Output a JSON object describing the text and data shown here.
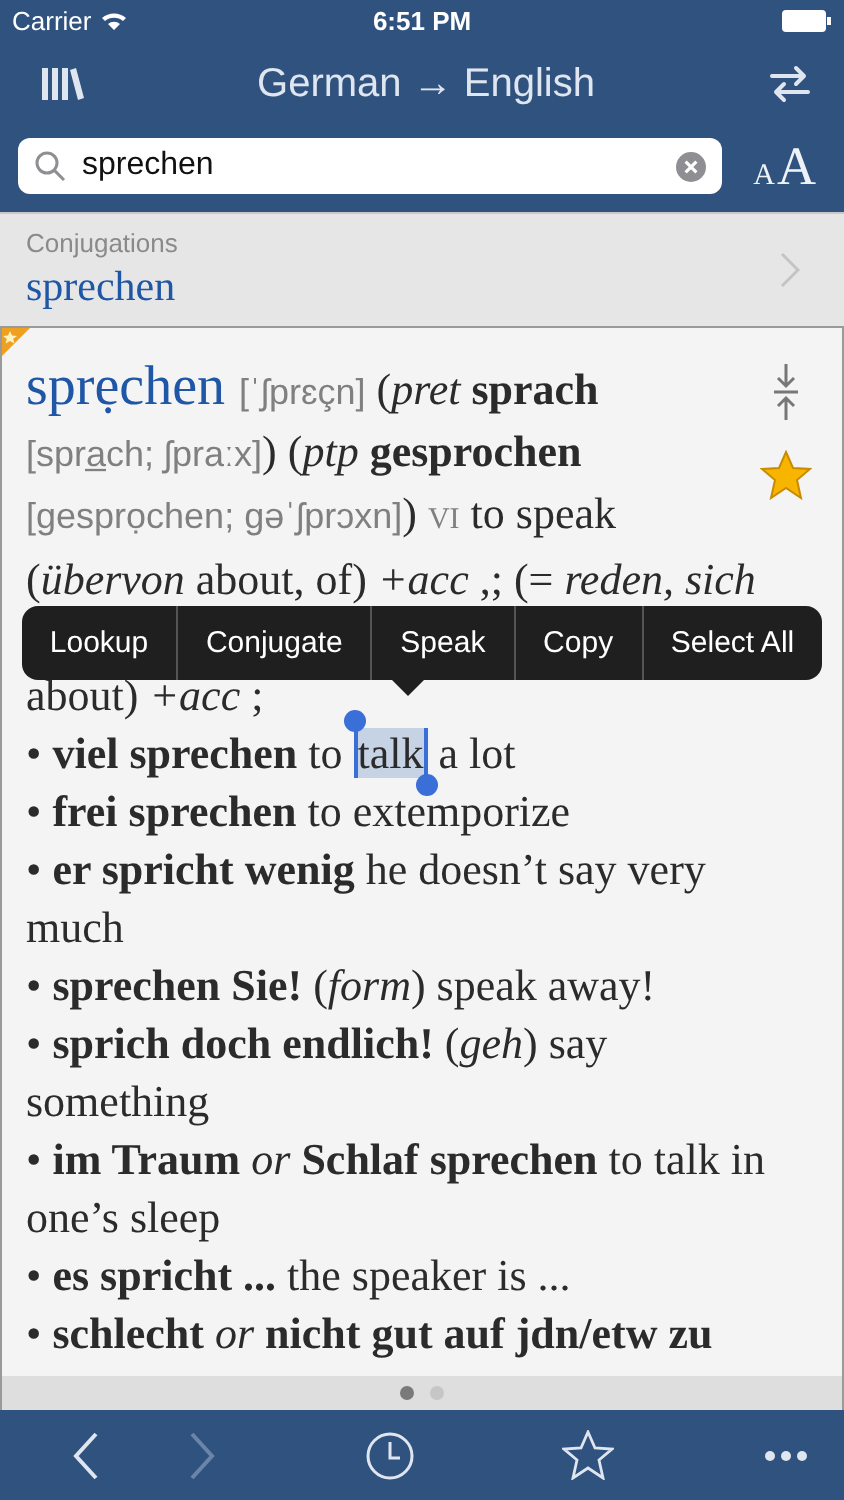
{
  "status_bar": {
    "carrier": "Carrier",
    "time": "6:51 PM"
  },
  "nav": {
    "title": "German → English"
  },
  "search": {
    "value": "sprechen",
    "font_button": {
      "small": "A",
      "large": "A"
    }
  },
  "conjugations": {
    "label": "Conjugations",
    "word": "sprechen"
  },
  "entry": {
    "bookmarked": true,
    "favorite": true,
    "head_lines": [
      [
        {
          "kind": "headword",
          "text": "sprẹchen "
        },
        {
          "kind": "phonetic",
          "text": "[ˈʃprɛçn]"
        },
        {
          "kind": "text",
          "text": " ("
        },
        {
          "kind": "italic",
          "text": "pret"
        },
        {
          "kind": "bold",
          "text": " sprach"
        }
      ],
      [
        {
          "kind": "phonetic",
          "text": "[spra̲ch; ʃpraːx]"
        },
        {
          "kind": "text",
          "text": ") ("
        },
        {
          "kind": "italic",
          "text": "ptp"
        },
        {
          "kind": "bold",
          "text": " gesprochen"
        }
      ],
      [
        {
          "kind": "phonetic",
          "text": "[gesprọchen; gəˈʃprɔxn]"
        },
        {
          "kind": "text",
          "text": ") "
        },
        {
          "kind": "smallcaps",
          "text": "VI"
        },
        {
          "kind": "text",
          "text": " to speak"
        }
      ],
      [
        {
          "kind": "text",
          "text": "("
        },
        {
          "kind": "italic",
          "text": "übervon"
        },
        {
          "kind": "text",
          "text": " about, of) "
        },
        {
          "kind": "italic",
          "text": "+acc"
        },
        {
          "kind": "text",
          "text": " ,; (= "
        },
        {
          "kind": "italic",
          "text": "reden, sich"
        }
      ]
    ],
    "tail_line": [
      {
        "kind": "text",
        "text": "about) "
      },
      {
        "kind": "italic",
        "text": "+acc"
      },
      {
        "kind": "text",
        "text": " ;"
      }
    ],
    "senses": [
      [
        {
          "kind": "text",
          "text": "• "
        },
        {
          "kind": "bold",
          "text": "viel sprechen"
        },
        {
          "kind": "text",
          "text": " to "
        },
        {
          "kind": "selected",
          "text": "talk"
        },
        {
          "kind": "text",
          "text": " a lot"
        }
      ],
      [
        {
          "kind": "text",
          "text": "• "
        },
        {
          "kind": "bold",
          "text": "frei sprechen"
        },
        {
          "kind": "text",
          "text": " to extemporize"
        }
      ],
      [
        {
          "kind": "text",
          "text": "• "
        },
        {
          "kind": "bold",
          "text": "er spricht wenig"
        },
        {
          "kind": "text",
          "text": " he doesn’t say very much"
        }
      ],
      [
        {
          "kind": "text",
          "text": "• "
        },
        {
          "kind": "bold",
          "text": "sprechen Sie!"
        },
        {
          "kind": "text",
          "text": " ("
        },
        {
          "kind": "italic",
          "text": "form"
        },
        {
          "kind": "text",
          "text": ") speak away!"
        }
      ],
      [
        {
          "kind": "text",
          "text": "• "
        },
        {
          "kind": "bold",
          "text": "sprich doch endlich!"
        },
        {
          "kind": "text",
          "text": " ("
        },
        {
          "kind": "italic",
          "text": "geh"
        },
        {
          "kind": "text",
          "text": ") say something"
        }
      ],
      [
        {
          "kind": "text",
          "text": "• "
        },
        {
          "kind": "bold",
          "text": "im Traum "
        },
        {
          "kind": "italic",
          "text": "or"
        },
        {
          "kind": "bold",
          "text": " Schlaf sprechen"
        },
        {
          "kind": "text",
          "text": " to talk in one’s sleep"
        }
      ],
      [
        {
          "kind": "text",
          "text": "• "
        },
        {
          "kind": "bold",
          "text": "es spricht ..."
        },
        {
          "kind": "text",
          "text": " the speaker is ..."
        }
      ],
      [
        {
          "kind": "text",
          "text": "• "
        },
        {
          "kind": "bold",
          "text": "schlecht "
        },
        {
          "kind": "italic",
          "text": "or"
        },
        {
          "kind": "bold",
          "text": " nicht gut auf jdn/etw zu"
        }
      ]
    ]
  },
  "context_menu": [
    "Lookup",
    "Conjugate",
    "Speak",
    "Copy",
    "Select All"
  ],
  "page_dots": [
    {
      "selected": true
    },
    {
      "selected": false
    }
  ],
  "toolbar": [
    {
      "kind": "back",
      "disabled": false
    },
    {
      "kind": "forward",
      "disabled": true
    },
    {
      "kind": "history"
    },
    {
      "kind": "favorites"
    },
    {
      "kind": "more"
    }
  ]
}
